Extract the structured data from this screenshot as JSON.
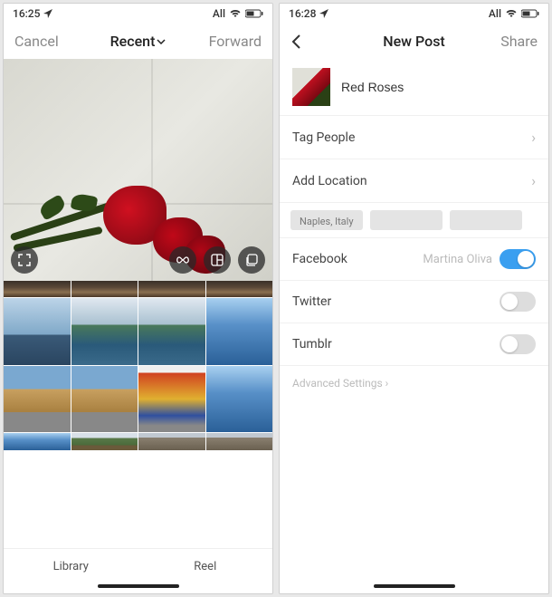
{
  "left": {
    "status": {
      "time": "16:25",
      "right_text": "All"
    },
    "nav": {
      "cancel": "Cancel",
      "title": "Recent",
      "forward": "Forward"
    },
    "tabs": {
      "library": "Library",
      "reel": "Reel"
    }
  },
  "right": {
    "status": {
      "time": "16:28",
      "right_text": "All"
    },
    "nav": {
      "title": "New Post",
      "share": "Share"
    },
    "caption": "Red Roses",
    "rows": {
      "tag_people": "Tag People",
      "add_location": "Add Location"
    },
    "location_suggestions": [
      "Naples, Italy",
      "",
      ""
    ],
    "sharing": {
      "facebook": {
        "label": "Facebook",
        "user": "Martina Oliva",
        "on": true
      },
      "twitter": {
        "label": "Twitter",
        "on": false
      },
      "tumblr": {
        "label": "Tumblr",
        "on": false
      }
    },
    "advanced": "Advanced Settings"
  }
}
